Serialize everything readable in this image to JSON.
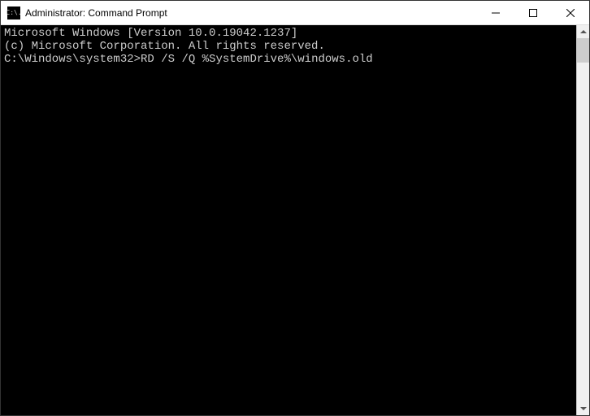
{
  "window": {
    "title": "Administrator: Command Prompt",
    "icon_label": "C:\\."
  },
  "terminal": {
    "line1": "Microsoft Windows [Version 10.0.19042.1237]",
    "line2": "(c) Microsoft Corporation. All rights reserved.",
    "blank": "",
    "prompt": "C:\\Windows\\system32>",
    "command": "RD /S /Q %SystemDrive%\\windows.old"
  }
}
